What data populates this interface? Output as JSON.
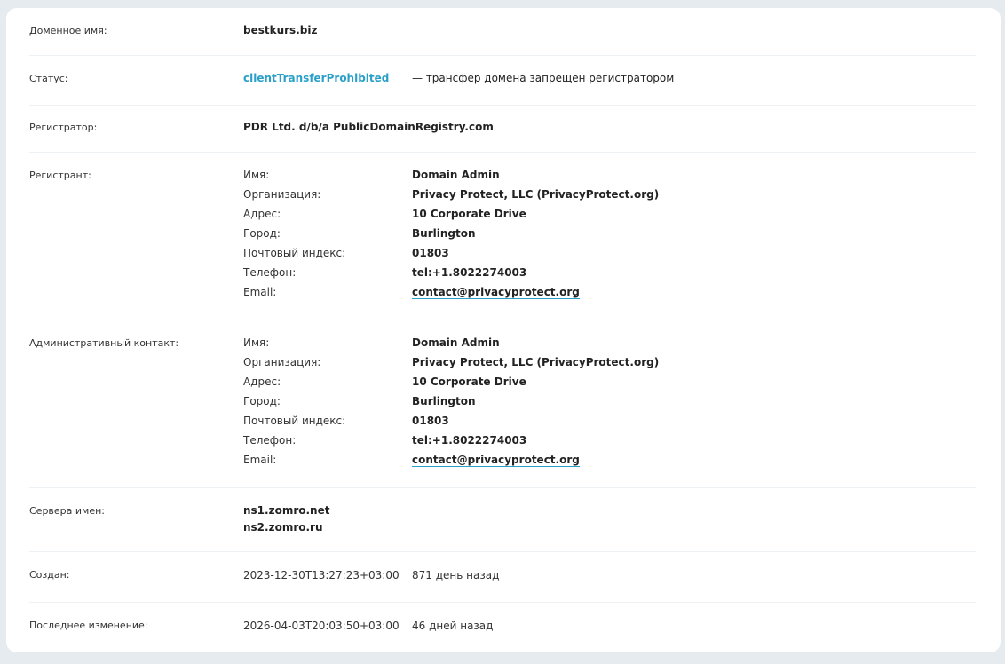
{
  "domain": {
    "label": "Доменное имя:",
    "value": "bestkurs.biz"
  },
  "status": {
    "label": "Статус:",
    "code": "clientTransferProhibited",
    "description": "— трансфер домена запрещен регистратором"
  },
  "registrar": {
    "label": "Регистратор:",
    "value": "PDR Ltd. d/b/a PublicDomainRegistry.com"
  },
  "registrant": {
    "label": "Регистрант:",
    "fields": [
      {
        "key": "Имя:",
        "value": "Domain Admin"
      },
      {
        "key": "Организация:",
        "value": "Privacy Protect, LLC (PrivacyProtect.org)"
      },
      {
        "key": "Адрес:",
        "value": "10 Corporate Drive"
      },
      {
        "key": "Город:",
        "value": "Burlington"
      },
      {
        "key": "Почтовый индекс:",
        "value": "01803"
      },
      {
        "key": "Телефон:",
        "value": "tel:+1.8022274003"
      },
      {
        "key": "Email:",
        "value": "contact@privacyprotect.org"
      }
    ]
  },
  "admin": {
    "label": "Административный контакт:",
    "fields": [
      {
        "key": "Имя:",
        "value": "Domain Admin"
      },
      {
        "key": "Организация:",
        "value": "Privacy Protect, LLC (PrivacyProtect.org)"
      },
      {
        "key": "Адрес:",
        "value": "10 Corporate Drive"
      },
      {
        "key": "Город:",
        "value": "Burlington"
      },
      {
        "key": "Почтовый индекс:",
        "value": "01803"
      },
      {
        "key": "Телефон:",
        "value": "tel:+1.8022274003"
      },
      {
        "key": "Email:",
        "value": "contact@privacyprotect.org"
      }
    ]
  },
  "nameservers": {
    "label": "Сервера имен:",
    "values": [
      "ns1.zomro.net",
      "ns2.zomro.ru"
    ]
  },
  "created": {
    "label": "Создан:",
    "date": "2023-12-30T13:27:23+03:00",
    "ago": "871 день назад"
  },
  "updated": {
    "label": "Последнее изменение:",
    "date": "2026-04-03T20:03:50+03:00",
    "ago": "46 дней назад"
  },
  "colors": {
    "accent": "#2aa0c8",
    "background": "#e6ebf0",
    "card": "#ffffff",
    "divider": "#eef1f4"
  }
}
